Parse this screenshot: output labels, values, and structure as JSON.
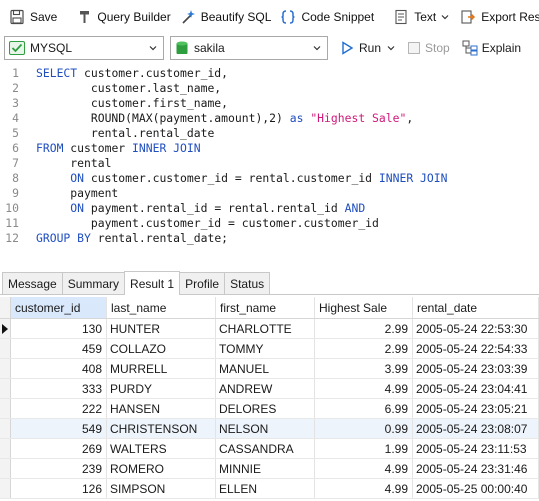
{
  "toolbar": {
    "save_label": "Save",
    "query_builder_label": "Query Builder",
    "beautify_label": "Beautify SQL",
    "code_snippet_label": "Code Snippet",
    "text_label": "Text",
    "export_label": "Export Result"
  },
  "connection": {
    "engine": "MYSQL",
    "database": "sakila",
    "run_label": "Run",
    "stop_label": "Stop",
    "explain_label": "Explain"
  },
  "editor": {
    "lines": [
      {
        "num": "1",
        "segments": [
          {
            "t": "kw",
            "v": "SELECT"
          },
          {
            "t": "plain",
            "v": " customer.customer_id,"
          }
        ]
      },
      {
        "num": "2",
        "segments": [
          {
            "t": "plain",
            "v": "        customer.last_name,"
          }
        ]
      },
      {
        "num": "3",
        "segments": [
          {
            "t": "plain",
            "v": "        customer.first_name,"
          }
        ]
      },
      {
        "num": "4",
        "segments": [
          {
            "t": "plain",
            "v": "        ROUND(MAX(payment.amount),2) "
          },
          {
            "t": "kw",
            "v": "as"
          },
          {
            "t": "plain",
            "v": " "
          },
          {
            "t": "str",
            "v": "\"Highest Sale\""
          },
          {
            "t": "plain",
            "v": ","
          }
        ]
      },
      {
        "num": "5",
        "segments": [
          {
            "t": "plain",
            "v": "        rental.rental_date"
          }
        ]
      },
      {
        "num": "6",
        "segments": [
          {
            "t": "kw",
            "v": "FROM"
          },
          {
            "t": "plain",
            "v": " customer "
          },
          {
            "t": "kw",
            "v": "INNER JOIN"
          }
        ]
      },
      {
        "num": "7",
        "segments": [
          {
            "t": "plain",
            "v": "     rental"
          }
        ]
      },
      {
        "num": "8",
        "segments": [
          {
            "t": "plain",
            "v": "     "
          },
          {
            "t": "kw",
            "v": "ON"
          },
          {
            "t": "plain",
            "v": " customer.customer_id = rental.customer_id "
          },
          {
            "t": "kw",
            "v": "INNER JOIN"
          }
        ]
      },
      {
        "num": "9",
        "segments": [
          {
            "t": "plain",
            "v": "     payment"
          }
        ]
      },
      {
        "num": "10",
        "segments": [
          {
            "t": "plain",
            "v": "     "
          },
          {
            "t": "kw",
            "v": "ON"
          },
          {
            "t": "plain",
            "v": " payment.rental_id = rental.rental_id "
          },
          {
            "t": "kw",
            "v": "AND"
          }
        ]
      },
      {
        "num": "11",
        "segments": [
          {
            "t": "plain",
            "v": "        payment.customer_id = customer.customer_id"
          }
        ]
      },
      {
        "num": "12",
        "segments": [
          {
            "t": "kw",
            "v": "GROUP BY"
          },
          {
            "t": "plain",
            "v": " rental.rental_date;"
          }
        ]
      }
    ]
  },
  "tabs": [
    {
      "label": "Message",
      "active": false
    },
    {
      "label": "Summary",
      "active": false
    },
    {
      "label": "Result 1",
      "active": true
    },
    {
      "label": "Profile",
      "active": false
    },
    {
      "label": "Status",
      "active": false
    }
  ],
  "grid": {
    "columns": [
      "customer_id",
      "last_name",
      "first_name",
      "Highest Sale",
      "rental_date"
    ],
    "rows": [
      [
        "130",
        "HUNTER",
        "CHARLOTTE",
        "2.99",
        "2005-05-24 22:53:30"
      ],
      [
        "459",
        "COLLAZO",
        "TOMMY",
        "2.99",
        "2005-05-24 22:54:33"
      ],
      [
        "408",
        "MURRELL",
        "MANUEL",
        "3.99",
        "2005-05-24 23:03:39"
      ],
      [
        "333",
        "PURDY",
        "ANDREW",
        "4.99",
        "2005-05-24 23:04:41"
      ],
      [
        "222",
        "HANSEN",
        "DELORES",
        "6.99",
        "2005-05-24 23:05:21"
      ],
      [
        "549",
        "CHRISTENSON",
        "NELSON",
        "0.99",
        "2005-05-24 23:08:07"
      ],
      [
        "269",
        "WALTERS",
        "CASSANDRA",
        "1.99",
        "2005-05-24 23:11:53"
      ],
      [
        "239",
        "ROMERO",
        "MINNIE",
        "4.99",
        "2005-05-24 23:31:46"
      ],
      [
        "126",
        "SIMPSON",
        "ELLEN",
        "4.99",
        "2005-05-25 00:00:40"
      ]
    ]
  },
  "colors": {
    "keyword": "#1f4ebf",
    "string": "#d0187a",
    "db_green": "#2e9e3e",
    "run_blue": "#1f6fd1",
    "sorted_header": "#d9e8fb"
  }
}
